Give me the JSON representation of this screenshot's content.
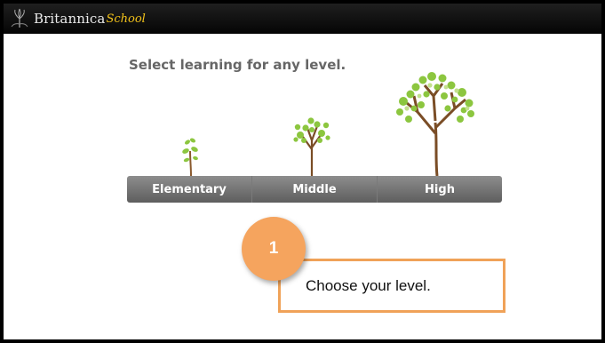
{
  "header": {
    "brand_name": "Britannica",
    "brand_sub": "School",
    "logo_icon": "thistle-logo-icon"
  },
  "main": {
    "headline": "Select learning for any level.",
    "levels": [
      {
        "label": "Elementary",
        "icon": "sprout-icon"
      },
      {
        "label": "Middle",
        "icon": "young-tree-icon"
      },
      {
        "label": "High",
        "icon": "mature-tree-icon"
      }
    ]
  },
  "callout": {
    "step_number": "1",
    "text": "Choose your level."
  },
  "colors": {
    "accent_orange": "#f5a45e",
    "callout_border": "#f0a258",
    "brand_yellow": "#f2c21a",
    "leaf_green": "#8cc63f",
    "bar_gray": "#6f6f6f"
  }
}
